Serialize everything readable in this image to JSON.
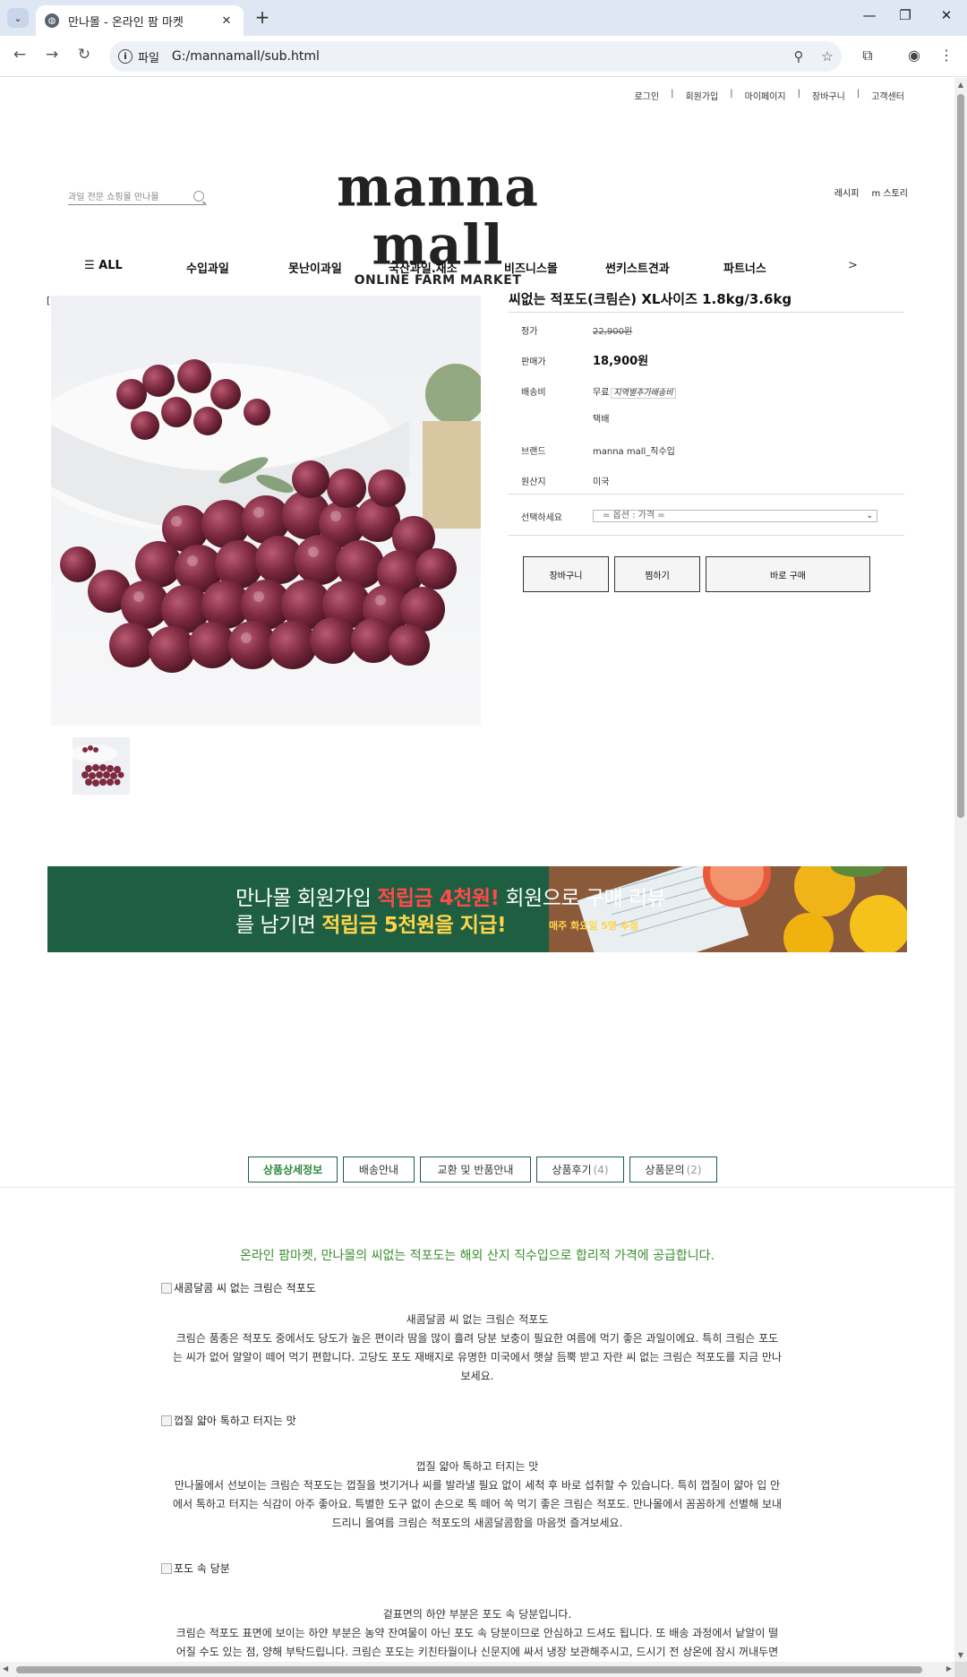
{
  "browser": {
    "tab_title": "만나몰 - 온라인 팜 마켓",
    "favicon": "globe-icon",
    "omnibox_chip": "파일",
    "url": "G:/mannamall/sub.html"
  },
  "site": {
    "util_links": [
      "로그인",
      "회원가입",
      "마이페이지",
      "장바구니",
      "고객센터"
    ],
    "search_placeholder": "과일 전문 쇼핑몰 만나몰",
    "logo_main": "manna mall",
    "logo_sub": "ONLINE FARM MARKET",
    "side_links": [
      "레시피",
      "m 스토리"
    ],
    "nav": [
      "☰ ALL",
      "수입과일",
      "못난이과일",
      "국산과일.채소",
      "비즈니스몰",
      "썬키스트견과",
      "파트너스"
    ],
    "nav_next": ">",
    "bracket": "["
  },
  "product": {
    "title": "씨없는 적포도(크림슨) XL사이즈 1.8kg/3.6kg",
    "rows": {
      "list_price_label": "정가",
      "list_price": "22,900원",
      "sale_price_label": "판매가",
      "sale_price": "18,900원",
      "shipping_label": "배송비",
      "shipping_value": "무료",
      "shipping_note": "지역별추가배송비",
      "shipping_method": "택배",
      "brand_label": "브랜드",
      "brand_value": "manna mall_직수입",
      "origin_label": "원산지",
      "origin_value": "미국"
    },
    "option_label": "선택하세요",
    "option_select": "= 옵션 : 가격 =",
    "buttons": {
      "cart": "장바구니",
      "wish": "찜하기",
      "buy": "바로 구매"
    }
  },
  "banner": {
    "line1_a": "만나몰 회원가입 ",
    "line1_b": "적립금 4천원!",
    "line1_c": " 회원으로 구매 리뷰",
    "line2_a": "를 남기면 ",
    "line2_b": "적립금 5천원을 지급!",
    "note": "매주 화요일 5명 추첨"
  },
  "tabs": [
    {
      "label": "상품상세정보",
      "count": ""
    },
    {
      "label": "배송안내",
      "count": ""
    },
    {
      "label": "교환 및 반품안내",
      "count": ""
    },
    {
      "label": "상품후기",
      "count": "(4)"
    },
    {
      "label": "상품문의",
      "count": "(2)"
    }
  ],
  "detail": {
    "lead": "온라인 팜마켓, 만나몰의 씨없는 적포도는 해외 산지 직수입으로 합리적 가격에 공급합니다.",
    "sections": [
      {
        "alt": "새콤달콤 씨 없는 크림슨 적포도",
        "heading": "새콤달콤 씨 없는 크림슨 적포도",
        "lines": [
          "크림슨 품종은 적포도 중에서도 당도가 높은 편이라 땀을 많이 흘려 당분 보충이 필요한 여름에 먹기 좋은 과일이에요. 특히 크림슨 포도",
          "는 씨가 없어 알알이 떼어 먹기 편합니다. 고당도 포도 재배지로 유명한 미국에서 햇살 듬뿍 받고 자란 씨 없는 크림슨 적포도를 지금 만나",
          "보세요."
        ]
      },
      {
        "alt": "껍질 얇아 톡하고 터지는 맛",
        "heading": "껍질 얇아 톡하고 터지는 맛",
        "lines": [
          "만나몰에서 선보이는 크림슨 적포도는 껍질을 벗기거나 씨를 발라낼 필요 없이 세척 후 바로 섭취할 수 있습니다. 특히 껍질이 얇아 입 안",
          "에서 톡하고 터지는 식감이 아주 좋아요. 특별한 도구 없이 손으로 톡 떼어 쏙 먹기 좋은 크림슨 적포도. 만나몰에서 꼼꼼하게 선별해 보내",
          "드리니 올여름 크림슨 적포도의 새콤달콤함을 마음껏 즐겨보세요."
        ]
      },
      {
        "alt": "포도 속 당분",
        "heading": "겉표면의 하얀 부분은 포도 속 당분입니다.",
        "lines": [
          "크림슨 적포도 표면에 보이는 하얀 부분은 농약 잔여물이 아닌 포도 속 당분이므로 안심하고 드셔도 됩니다. 또 배송 과정에서 낱알이 떨",
          "어질 수도 있는 점, 양해 부탁드립니다. 크림슨 포도는 키친타월이나 신문지에 싸서 냉장 보관해주시고, 드시기 전 상온에 잠시 꺼내두면"
        ]
      }
    ]
  }
}
